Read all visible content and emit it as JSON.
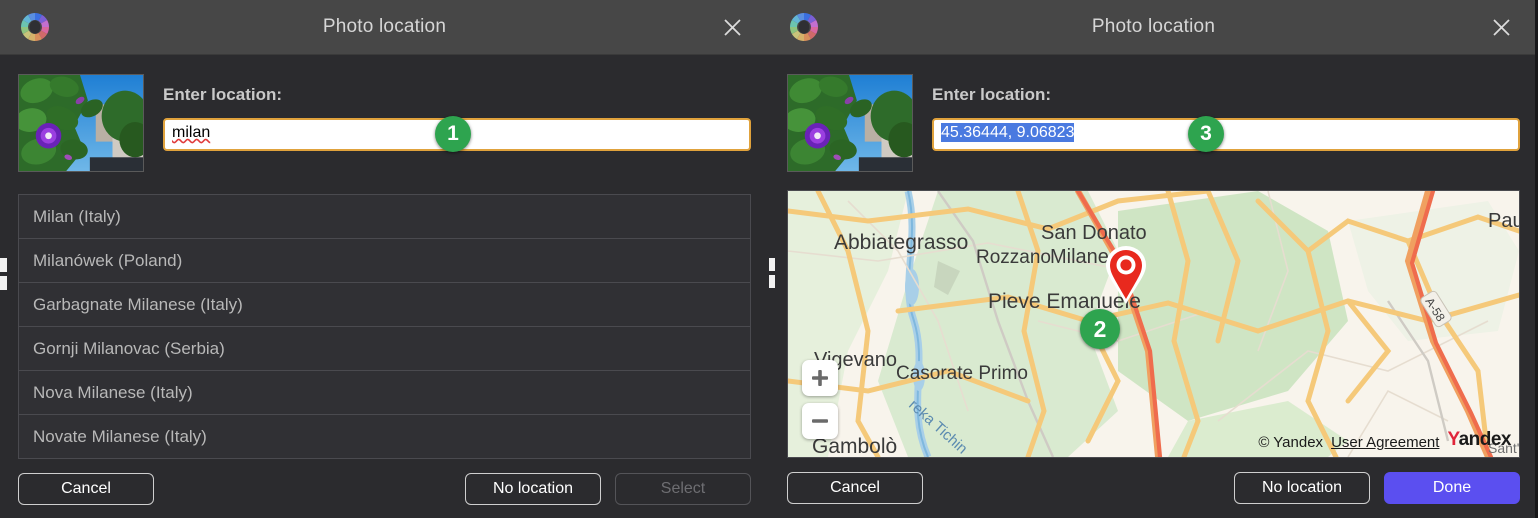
{
  "window": {
    "title": "Photo location",
    "app_icon": "color-wheel-icon",
    "close_icon": "close-icon"
  },
  "left_dialog": {
    "thumbnail_alt": "photo-thumbnail",
    "field_label": "Enter location:",
    "input": {
      "value": "milan",
      "placeholder": "",
      "spellcheck_underline": true,
      "selected": false
    },
    "suggestions": [
      "Milan (Italy)",
      "Milanówek (Poland)",
      "Garbagnate Milanese (Italy)",
      "Gornji Milanovac (Serbia)",
      "Nova Milanese (Italy)",
      "Novate Milanese (Italy)"
    ],
    "buttons": {
      "cancel": "Cancel",
      "no_location": "No location",
      "select": "Select",
      "select_disabled": true
    },
    "badge": "1"
  },
  "right_dialog": {
    "thumbnail_alt": "photo-thumbnail",
    "field_label": "Enter location:",
    "input": {
      "value": "45.36444, 9.06823",
      "placeholder": "",
      "selected": true
    },
    "map": {
      "provider": "Yandex",
      "copyright": "© Yandex",
      "user_agreement": "User Agreement",
      "logo_first_letter": "Y",
      "logo_rest": "andex",
      "zoom_in": "+",
      "zoom_out": "−",
      "marker": "map-pin-marker",
      "labels": [
        "Abbiategrasso",
        "San Donato",
        "Milanese",
        "Rozzano",
        "Pieve Emanuele",
        "Paullo",
        "Vigevano",
        "Casorate Primo",
        "Gambolò",
        "reka Tichin",
        "A-58"
      ]
    },
    "buttons": {
      "cancel": "Cancel",
      "no_location": "No location",
      "done": "Done"
    },
    "badge_map": "2",
    "badge_input": "3"
  },
  "colors": {
    "titlebar": "#474747",
    "dialog_bg": "#2b2b2e",
    "input_border_focus": "#e0a23c",
    "badge_green": "#2ea44f",
    "primary_button": "#5b4ff0",
    "selection_blue": "#4a7ae0",
    "marker_red": "#e8291e"
  }
}
